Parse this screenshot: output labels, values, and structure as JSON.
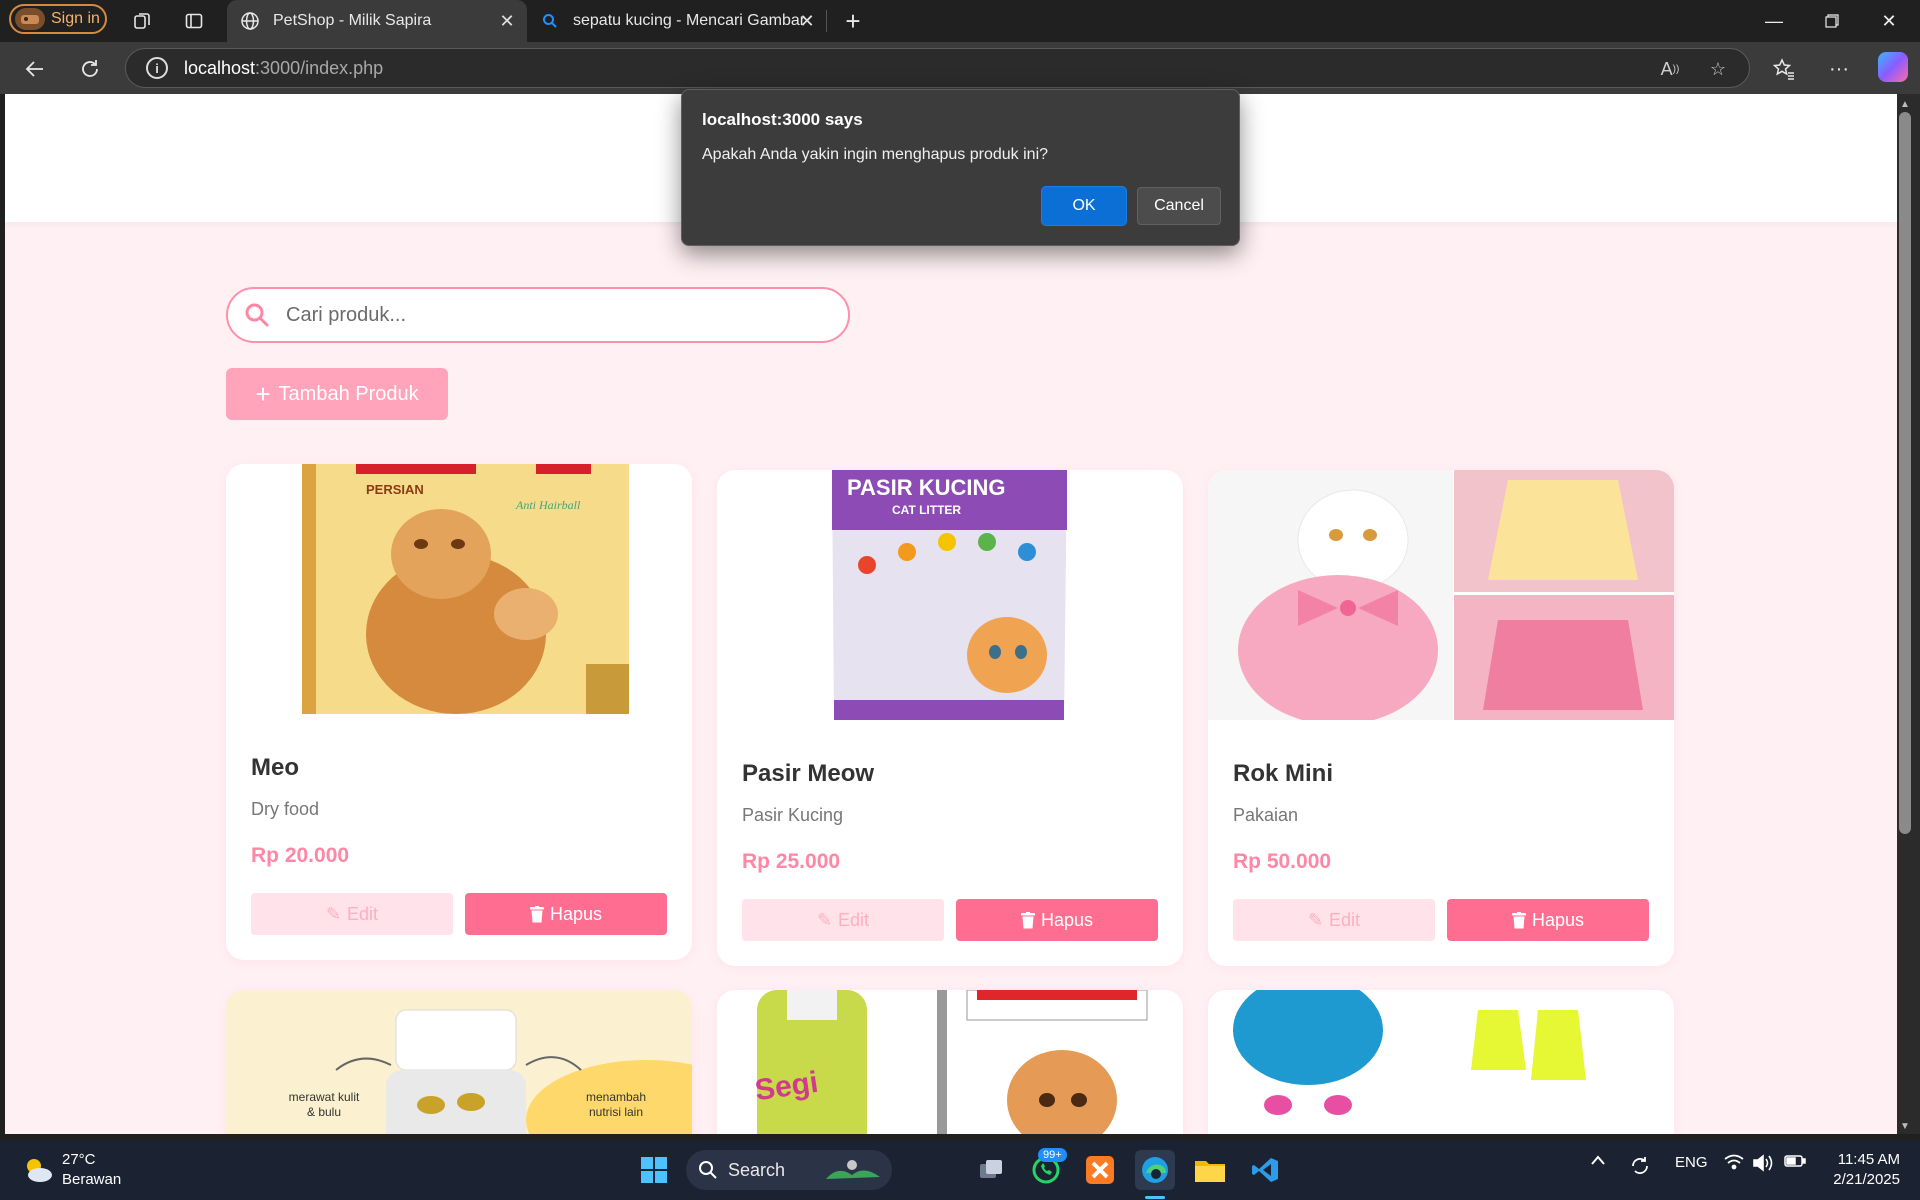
{
  "browser": {
    "profile_button": "Sign in",
    "tabs": [
      {
        "title": "PetShop - Milik Sapira",
        "active": true,
        "icon": "globe-icon"
      },
      {
        "title": "sepatu kucing - Mencari Gambar",
        "active": false,
        "icon": "search-icon"
      }
    ],
    "url_host": "localhost",
    "url_path": ":3000/index.php"
  },
  "page": {
    "search_placeholder": "Cari produk...",
    "add_button": "Tambah Produk",
    "products": [
      {
        "name": "Meo",
        "category": "Dry food",
        "price": "Rp 20.000",
        "edit": "Edit",
        "delete": "Hapus",
        "image": "cat-food-bag-image"
      },
      {
        "name": "Pasir Meow",
        "category": "Pasir Kucing",
        "price": "Rp 25.000",
        "edit": "Edit",
        "delete": "Hapus",
        "image": "cat-litter-bag-image"
      },
      {
        "name": "Rok Mini",
        "category": "Pakaian",
        "price": "Rp 50.000",
        "edit": "Edit",
        "delete": "Hapus",
        "image": "cat-dress-image"
      }
    ],
    "partial_images": {
      "vitamin_left": "merawat kulit & bulu",
      "vitamin_right": "menambah nutrisi lain",
      "bottle_label": "Segi"
    }
  },
  "dialog": {
    "title": "localhost:3000 says",
    "message": "Apakah Anda yakin ingin menghapus produk ini?",
    "ok": "OK",
    "cancel": "Cancel"
  },
  "taskbar": {
    "temperature": "27°C",
    "weather": "Berawan",
    "search": "Search",
    "notification_badge": "99+",
    "language": "ENG",
    "time": "11:45 AM",
    "date": "2/21/2025"
  },
  "colors": {
    "accent_pink": "#ff6e91",
    "light_pink": "#ffa4bb",
    "price_pink": "#ff86a4",
    "page_bg": "#fff0f4",
    "dialog_ok": "#0b6fd6"
  }
}
